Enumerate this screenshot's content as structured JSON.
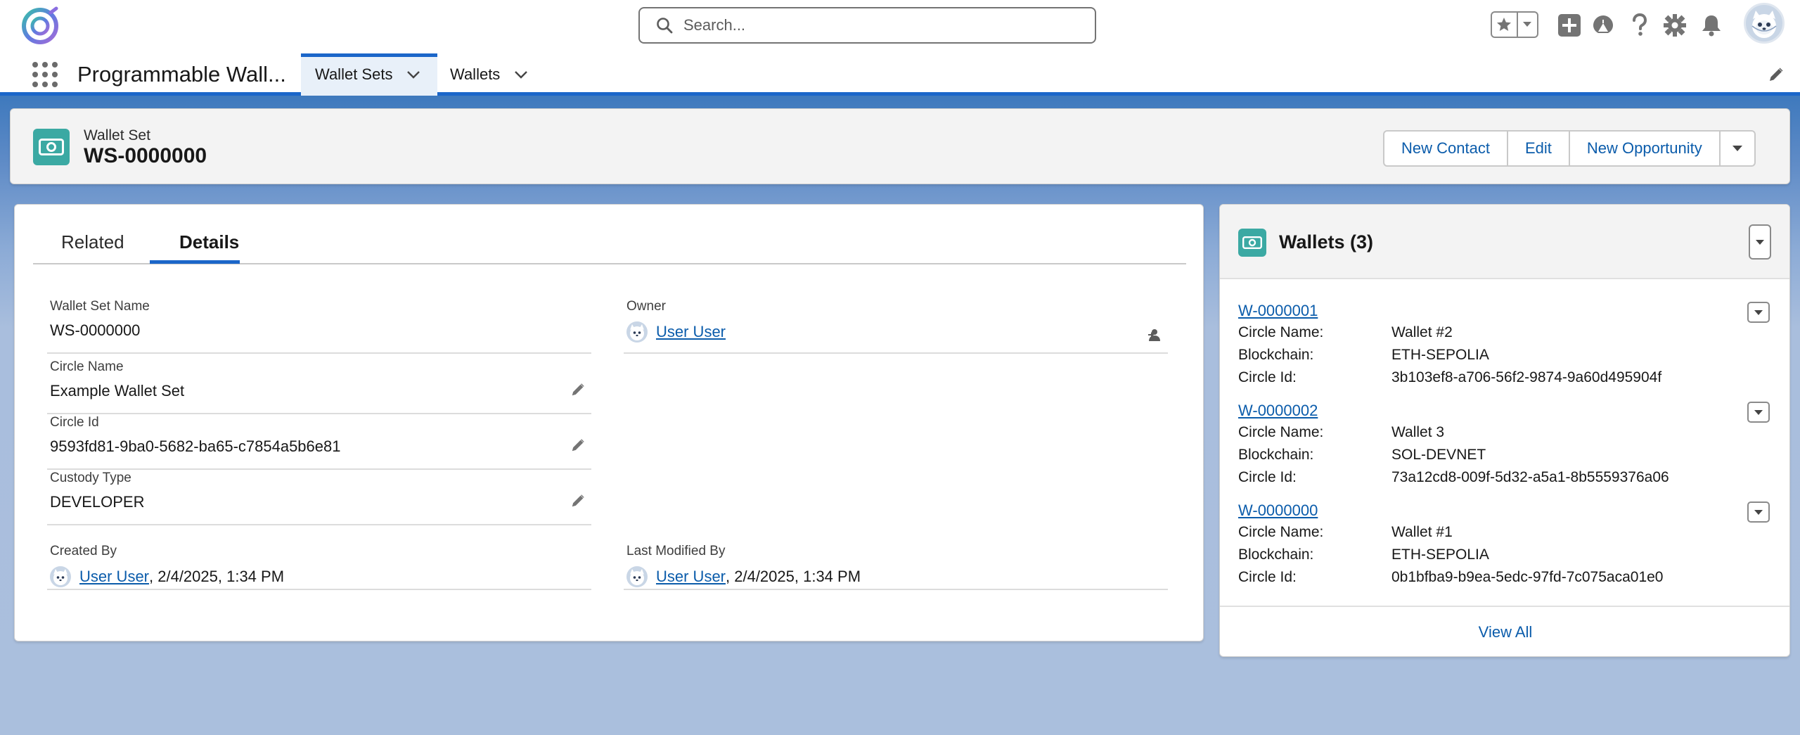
{
  "header": {
    "search_placeholder": "Search...",
    "icons": [
      "app-logo-icon",
      "search-icon",
      "star-icon",
      "chevron-down-icon",
      "plus-icon",
      "trailhead-icon",
      "help-icon",
      "gear-icon",
      "bell-icon",
      "avatar"
    ]
  },
  "nav": {
    "app_name": "Programmable Wall...",
    "tabs": [
      {
        "label": "Wallet Sets",
        "active": true
      },
      {
        "label": "Wallets",
        "active": false
      }
    ]
  },
  "record": {
    "type_label": "Wallet Set",
    "title": "WS-0000000",
    "actions": [
      "New Contact",
      "Edit",
      "New Opportunity"
    ]
  },
  "details": {
    "tabs": [
      "Related",
      "Details"
    ],
    "active_tab": "Details",
    "fields": {
      "wallet_set_name": {
        "label": "Wallet Set Name",
        "value": "WS-0000000"
      },
      "owner": {
        "label": "Owner",
        "value": "User User"
      },
      "circle_name": {
        "label": "Circle Name",
        "value": "Example Wallet Set"
      },
      "circle_id": {
        "label": "Circle Id",
        "value": "9593fd81-9ba0-5682-ba65-c7854a5b6e81"
      },
      "custody_type": {
        "label": "Custody Type",
        "value": "DEVELOPER"
      },
      "created_by": {
        "label": "Created By",
        "user": "User User",
        "date": ", 2/4/2025, 1:34 PM"
      },
      "last_modified_by": {
        "label": "Last Modified By",
        "user": "User User",
        "date": ", 2/4/2025, 1:34 PM"
      }
    }
  },
  "wallets": {
    "title": "Wallets (3)",
    "labels": {
      "circle_name": "Circle Name:",
      "blockchain": "Blockchain:",
      "circle_id": "Circle Id:"
    },
    "items": [
      {
        "id": "W-0000001",
        "circle_name": "Wallet #2",
        "blockchain": "ETH-SEPOLIA",
        "circle_id": "3b103ef8-a706-56f2-9874-9a60d495904f"
      },
      {
        "id": "W-0000002",
        "circle_name": "Wallet 3",
        "blockchain": "SOL-DEVNET",
        "circle_id": "73a12cd8-009f-5d32-a5a1-8b5559376a06"
      },
      {
        "id": "W-0000000",
        "circle_name": "Wallet #1",
        "blockchain": "ETH-SEPOLIA",
        "circle_id": "0b1bfba9-b9ea-5edc-97fd-7c075aca01e0"
      }
    ],
    "view_all": "View All"
  },
  "colors": {
    "brand_blue": "#1b66c9",
    "link": "#0b5cab",
    "record_icon": "#3ba9a3"
  }
}
